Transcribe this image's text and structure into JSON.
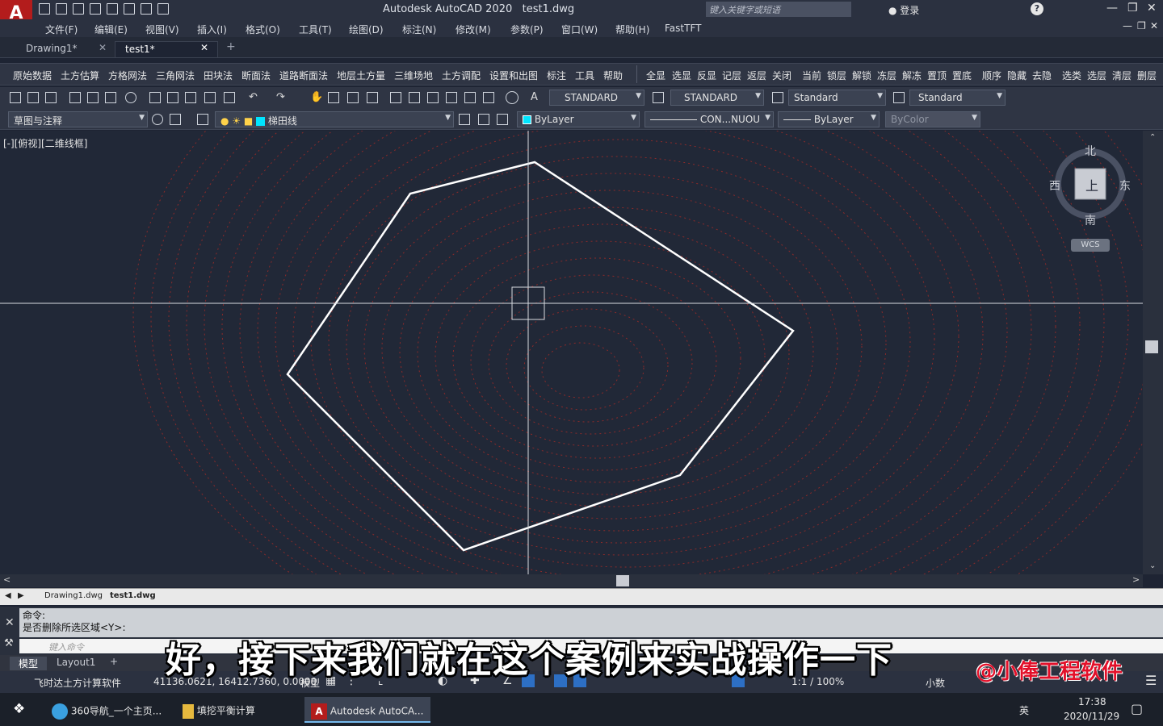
{
  "app": {
    "logo": "A",
    "title": "Autodesk AutoCAD 2020",
    "filename": "test1.dwg",
    "search_placeholder": "键入关键字或短语",
    "login": "登录",
    "help": "?"
  },
  "menu": [
    "文件(F)",
    "编辑(E)",
    "视图(V)",
    "插入(I)",
    "格式(O)",
    "工具(T)",
    "绘图(D)",
    "标注(N)",
    "修改(M)",
    "参数(P)",
    "窗口(W)",
    "帮助(H)",
    "FastTFT"
  ],
  "tabs": [
    {
      "label": "Drawing1*"
    },
    {
      "label": "test1*"
    }
  ],
  "tb1_left": [
    "原始数据",
    "土方估算",
    "方格网法",
    "三角网法",
    "田块法",
    "断面法",
    "道路断面法",
    "地层土方量",
    "三维场地",
    "土方调配",
    "设置和出图",
    "标注",
    "工具",
    "帮助"
  ],
  "tb1_right": [
    "全显",
    "选显",
    "反显",
    "记层",
    "返层",
    "关闭",
    "当前",
    "锁层",
    "解锁",
    "冻层",
    "解冻",
    "置顶",
    "置底",
    "顺序",
    "隐藏",
    "去隐",
    "选类",
    "选层",
    "清层",
    "删层"
  ],
  "styles": {
    "text": "STANDARD",
    "dim": "STANDARD",
    "table": "Standard",
    "mleader": "Standard"
  },
  "layers": {
    "workspace": "草图与注释",
    "layer": "梯田线",
    "color": "ByLayer",
    "linetype": "CON...NUOU",
    "lineweight": "ByLayer",
    "plotstyle": "ByColor"
  },
  "viewport": {
    "label": "[-][俯视][二维线框]"
  },
  "compass": {
    "north": "北",
    "south": "南",
    "east": "东",
    "west": "西",
    "top": "上",
    "wcs": "WCS"
  },
  "layout_tabs": [
    "Drawing1.dwg",
    "test1.dwg"
  ],
  "command": {
    "line1": "命令:",
    "line2": "是否删除所选区域<Y>:",
    "placeholder": "键入命令"
  },
  "model_tabs": {
    "model": "模型",
    "layout1": "Layout1",
    "plus": "+"
  },
  "status": {
    "app": "飞时达土方计算软件",
    "coords": "41136.0621, 16412.7360, 0.0000",
    "model": "模型",
    "scale": "1:1 / 100%",
    "units": "小数"
  },
  "taskbar": {
    "items": [
      "360导航_一个主页...",
      "填挖平衡计算",
      "Autodesk AutoCA..."
    ],
    "time": "17:38",
    "date": "2020/11/29",
    "ime": "英"
  },
  "overlay": {
    "subtitle": "好，接下来我们就在这个案例来实战操作一下",
    "watermark": "@小俸工程软件"
  },
  "colors": {
    "accent": "#b31c1c",
    "contour": "#8a2a2a",
    "polygon": "#ffffff",
    "canvas": "#212837"
  }
}
